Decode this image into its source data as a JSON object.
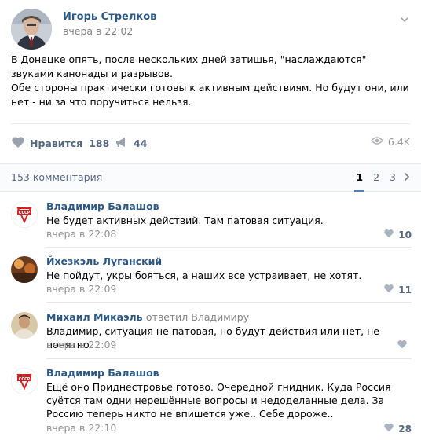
{
  "post": {
    "author": "Игорь Стрелков",
    "time": "вчера в 22:02",
    "text_lines": [
      "В Донецке опять, после нескольких дней затишья, \"наслаждаются\" звуками канонады и разрывов.",
      "Обе стороны практически готовы к активным действиям. Но будут они, или нет - ни за что поручиться нельзя."
    ]
  },
  "actions": {
    "like_label": "Нравится",
    "like_count": "188",
    "share_count": "44",
    "views": "6.4K"
  },
  "comments_bar": {
    "count_label": "153 комментария",
    "pages": [
      "1",
      "2",
      "3"
    ]
  },
  "comments": [
    {
      "name": "Владимир Балашов",
      "replied": "",
      "text": "Не будет активных действий. Там патовая ситуация.",
      "time": "вчера в 22:08",
      "likes": "10",
      "avatar": "ussr-quality-mark-icon"
    },
    {
      "name": "Йхезкэль Луганский",
      "replied": "",
      "text": "Не пойдут, укры бояться, а наших все устраивает, не хотят.",
      "time": "вчера в 22:09",
      "likes": "11",
      "avatar": "photo-avatar"
    },
    {
      "name": "Михаил Микаэль",
      "replied": "ответил Владимиру",
      "text": "Владимир, ситуация не патовая, но будут действия или нет, не понятно.",
      "time": "вчера в 22:09",
      "likes": "",
      "avatar": "photo-avatar"
    },
    {
      "name": "Владимир Балашов",
      "replied": "",
      "text": "Ещё оно Приднестровье готово. Очередной гнидник. Куда Россия суётся там одни нерешённые вопросы и недоделанные дела. За Россию теперь никто не впишется уже.. Себе дороже..",
      "time": "вчера в 22:10",
      "likes": "28",
      "avatar": "ussr-quality-mark-icon"
    }
  ],
  "colors": {
    "link": "#2a5885",
    "muted": "#828282",
    "accent": "#5181b8",
    "border": "#e7e8ec"
  }
}
